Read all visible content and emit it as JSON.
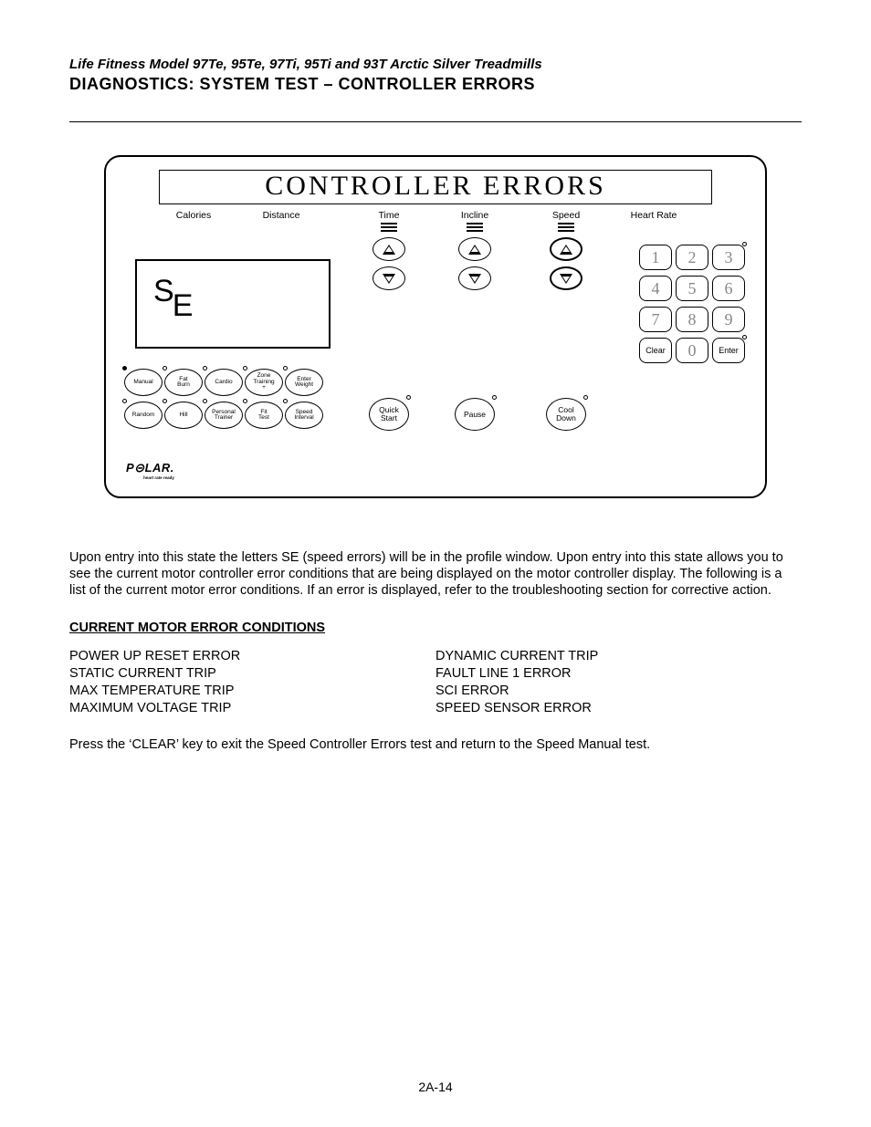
{
  "header": {
    "sub": "Life Fitness Model 97Te, 95Te, 97Ti, 95Ti and 93T Arctic Silver Treadmills",
    "main": "DIAGNOSTICS: SYSTEM TEST – CONTROLLER ERRORS"
  },
  "panel": {
    "title": "CONTROLLER ERRORS",
    "labels": {
      "calories": "Calories",
      "distance": "Distance",
      "time": "Time",
      "incline": "Incline",
      "speed": "Speed",
      "heartrate": "Heart Rate"
    },
    "profile": {
      "letter1": "S",
      "letter2": "E"
    },
    "keypad": [
      "1",
      "2",
      "3",
      "4",
      "5",
      "6",
      "7",
      "8",
      "9",
      "Clear",
      "0",
      "Enter"
    ],
    "programs_row1": [
      "Manual",
      "Fat\nBurn",
      "Cardio",
      "Zone\nTraining\n+",
      "Enter\nWeight"
    ],
    "programs_row2": [
      "Random",
      "Hill",
      "Personal\nTrainer",
      "Fit\nTest",
      "Speed\nInterval"
    ],
    "mid": {
      "quick": "Quick\nStart",
      "pause": "Pause",
      "cool": "Cool\nDown"
    },
    "polar": "P⊝LAR",
    "polar_sub": "heart rate ready"
  },
  "para": "Upon entry into this state the letters SE (speed errors) will be in the profile window. Upon entry into this state allows you to see the current motor controller error conditions that are being displayed on the motor controller display. The following is a list of the current motor error conditions. If an error is displayed, refer to the troubleshooting section for corrective action.",
  "section_heading": "CURRENT MOTOR ERROR CONDITIONS",
  "errors_left": [
    "POWER UP RESET ERROR",
    "STATIC CURRENT TRIP",
    "MAX TEMPERATURE TRIP",
    "MAXIMUM VOLTAGE TRIP"
  ],
  "errors_right": [
    "DYNAMIC CURRENT TRIP",
    "FAULT LINE 1 ERROR",
    "SCI ERROR",
    "SPEED SENSOR ERROR"
  ],
  "footer_text": "Press the ‘CLEAR’ key to exit the Speed Controller Errors test and return to the Speed Manual test.",
  "page_number": "2A-14"
}
